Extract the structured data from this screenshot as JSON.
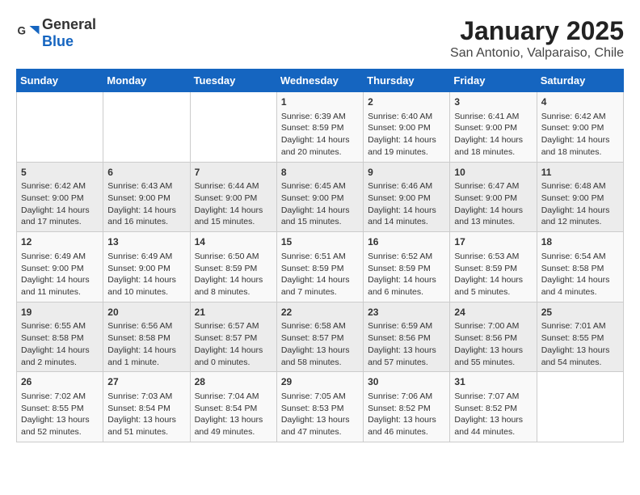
{
  "header": {
    "logo_general": "General",
    "logo_blue": "Blue",
    "month_year": "January 2025",
    "location": "San Antonio, Valparaiso, Chile"
  },
  "weekdays": [
    "Sunday",
    "Monday",
    "Tuesday",
    "Wednesday",
    "Thursday",
    "Friday",
    "Saturday"
  ],
  "weeks": [
    [
      {
        "day": "",
        "text": ""
      },
      {
        "day": "",
        "text": ""
      },
      {
        "day": "",
        "text": ""
      },
      {
        "day": "1",
        "text": "Sunrise: 6:39 AM\nSunset: 8:59 PM\nDaylight: 14 hours\nand 20 minutes."
      },
      {
        "day": "2",
        "text": "Sunrise: 6:40 AM\nSunset: 9:00 PM\nDaylight: 14 hours\nand 19 minutes."
      },
      {
        "day": "3",
        "text": "Sunrise: 6:41 AM\nSunset: 9:00 PM\nDaylight: 14 hours\nand 18 minutes."
      },
      {
        "day": "4",
        "text": "Sunrise: 6:42 AM\nSunset: 9:00 PM\nDaylight: 14 hours\nand 18 minutes."
      }
    ],
    [
      {
        "day": "5",
        "text": "Sunrise: 6:42 AM\nSunset: 9:00 PM\nDaylight: 14 hours\nand 17 minutes."
      },
      {
        "day": "6",
        "text": "Sunrise: 6:43 AM\nSunset: 9:00 PM\nDaylight: 14 hours\nand 16 minutes."
      },
      {
        "day": "7",
        "text": "Sunrise: 6:44 AM\nSunset: 9:00 PM\nDaylight: 14 hours\nand 15 minutes."
      },
      {
        "day": "8",
        "text": "Sunrise: 6:45 AM\nSunset: 9:00 PM\nDaylight: 14 hours\nand 15 minutes."
      },
      {
        "day": "9",
        "text": "Sunrise: 6:46 AM\nSunset: 9:00 PM\nDaylight: 14 hours\nand 14 minutes."
      },
      {
        "day": "10",
        "text": "Sunrise: 6:47 AM\nSunset: 9:00 PM\nDaylight: 14 hours\nand 13 minutes."
      },
      {
        "day": "11",
        "text": "Sunrise: 6:48 AM\nSunset: 9:00 PM\nDaylight: 14 hours\nand 12 minutes."
      }
    ],
    [
      {
        "day": "12",
        "text": "Sunrise: 6:49 AM\nSunset: 9:00 PM\nDaylight: 14 hours\nand 11 minutes."
      },
      {
        "day": "13",
        "text": "Sunrise: 6:49 AM\nSunset: 9:00 PM\nDaylight: 14 hours\nand 10 minutes."
      },
      {
        "day": "14",
        "text": "Sunrise: 6:50 AM\nSunset: 8:59 PM\nDaylight: 14 hours\nand 8 minutes."
      },
      {
        "day": "15",
        "text": "Sunrise: 6:51 AM\nSunset: 8:59 PM\nDaylight: 14 hours\nand 7 minutes."
      },
      {
        "day": "16",
        "text": "Sunrise: 6:52 AM\nSunset: 8:59 PM\nDaylight: 14 hours\nand 6 minutes."
      },
      {
        "day": "17",
        "text": "Sunrise: 6:53 AM\nSunset: 8:59 PM\nDaylight: 14 hours\nand 5 minutes."
      },
      {
        "day": "18",
        "text": "Sunrise: 6:54 AM\nSunset: 8:58 PM\nDaylight: 14 hours\nand 4 minutes."
      }
    ],
    [
      {
        "day": "19",
        "text": "Sunrise: 6:55 AM\nSunset: 8:58 PM\nDaylight: 14 hours\nand 2 minutes."
      },
      {
        "day": "20",
        "text": "Sunrise: 6:56 AM\nSunset: 8:58 PM\nDaylight: 14 hours\nand 1 minute."
      },
      {
        "day": "21",
        "text": "Sunrise: 6:57 AM\nSunset: 8:57 PM\nDaylight: 14 hours\nand 0 minutes."
      },
      {
        "day": "22",
        "text": "Sunrise: 6:58 AM\nSunset: 8:57 PM\nDaylight: 13 hours\nand 58 minutes."
      },
      {
        "day": "23",
        "text": "Sunrise: 6:59 AM\nSunset: 8:56 PM\nDaylight: 13 hours\nand 57 minutes."
      },
      {
        "day": "24",
        "text": "Sunrise: 7:00 AM\nSunset: 8:56 PM\nDaylight: 13 hours\nand 55 minutes."
      },
      {
        "day": "25",
        "text": "Sunrise: 7:01 AM\nSunset: 8:55 PM\nDaylight: 13 hours\nand 54 minutes."
      }
    ],
    [
      {
        "day": "26",
        "text": "Sunrise: 7:02 AM\nSunset: 8:55 PM\nDaylight: 13 hours\nand 52 minutes."
      },
      {
        "day": "27",
        "text": "Sunrise: 7:03 AM\nSunset: 8:54 PM\nDaylight: 13 hours\nand 51 minutes."
      },
      {
        "day": "28",
        "text": "Sunrise: 7:04 AM\nSunset: 8:54 PM\nDaylight: 13 hours\nand 49 minutes."
      },
      {
        "day": "29",
        "text": "Sunrise: 7:05 AM\nSunset: 8:53 PM\nDaylight: 13 hours\nand 47 minutes."
      },
      {
        "day": "30",
        "text": "Sunrise: 7:06 AM\nSunset: 8:52 PM\nDaylight: 13 hours\nand 46 minutes."
      },
      {
        "day": "31",
        "text": "Sunrise: 7:07 AM\nSunset: 8:52 PM\nDaylight: 13 hours\nand 44 minutes."
      },
      {
        "day": "",
        "text": ""
      }
    ]
  ]
}
